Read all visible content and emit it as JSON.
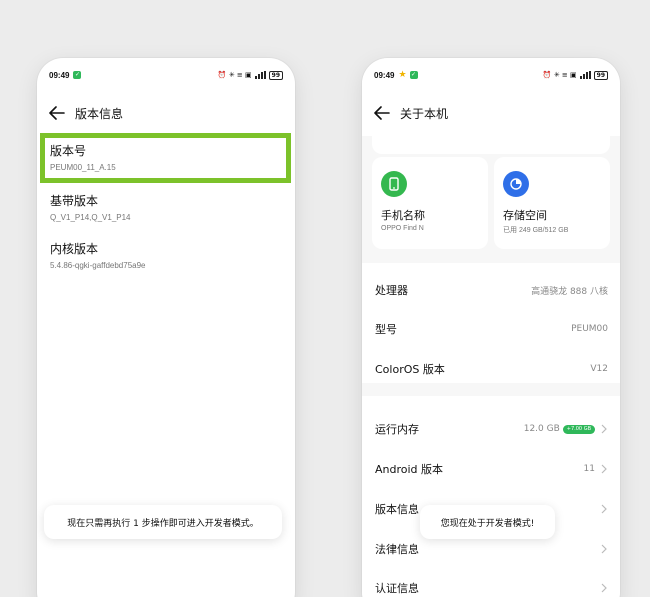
{
  "left_screen": {
    "status_time": "09:49",
    "status_right": "⏰ ✳ ≡ ▣",
    "battery": "99",
    "title": "版本信息",
    "items": [
      {
        "label": "版本号",
        "value": "PEUM00_11_A.15"
      },
      {
        "label": "基带版本",
        "value": "Q_V1_P14,Q_V1_P14"
      },
      {
        "label": "内核版本",
        "value": "5.4.86-qgki-gaffdebd75a9e"
      }
    ],
    "toast": "现在只需再执行 1 步操作即可进入开发者模式。"
  },
  "right_screen": {
    "status_time": "09:49",
    "status_right": "⏰ ✳ ≡ ▣",
    "battery": "99",
    "title": "关于本机",
    "cards": [
      {
        "title": "手机名称",
        "sub": "OPPO Find N",
        "icon": "phone-icon",
        "color": "#34b84f"
      },
      {
        "title": "存储空间",
        "sub": "已用 249 GB/512 GB",
        "icon": "storage-pie-icon",
        "color": "#2f6fe8"
      }
    ],
    "rows": [
      {
        "label": "处理器",
        "value": "高通骁龙 888 八核"
      },
      {
        "label": "型号",
        "value": "PEUM00"
      },
      {
        "label": "ColorOS 版本",
        "value": "V12"
      },
      {
        "label": "运行内存",
        "value": "12.0 GB",
        "badge": "+7.00 GB"
      },
      {
        "label": "Android 版本",
        "value": "11"
      },
      {
        "label": "版本信息",
        "value": ""
      },
      {
        "label": "法律信息",
        "value": ""
      },
      {
        "label": "认证信息",
        "value": ""
      }
    ],
    "toast": "您现在处于开发者模式!"
  },
  "colors": {
    "highlight": "#7cc22a",
    "accent_green": "#2fb85a",
    "accent_blue": "#2f6fe8"
  }
}
